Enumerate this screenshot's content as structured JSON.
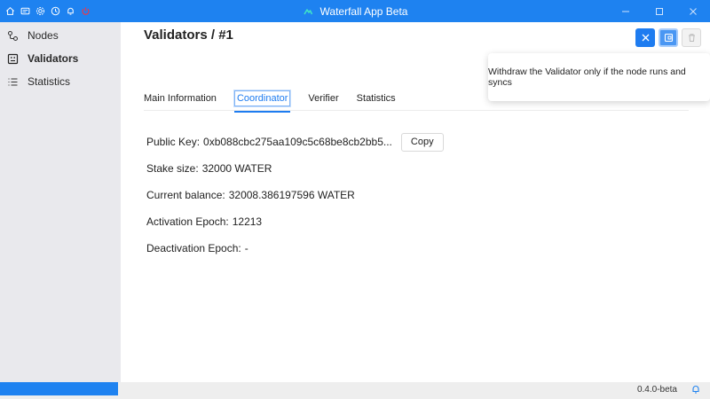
{
  "window": {
    "title": "Waterfall App Beta",
    "accent_color": "#1e82f0",
    "left_icons": [
      "home-icon",
      "wallet-icon",
      "settings-icon",
      "clock-icon",
      "bell-icon",
      "power-icon"
    ],
    "controls": [
      "minimize-icon",
      "maximize-icon",
      "close-icon"
    ]
  },
  "sidebar": {
    "items": [
      {
        "label": "Nodes",
        "icon": "nodes-icon",
        "active": false
      },
      {
        "label": "Validators",
        "icon": "validator-icon",
        "active": true
      },
      {
        "label": "Statistics",
        "icon": "list-icon",
        "active": false
      }
    ]
  },
  "page": {
    "title": "Validators / #1"
  },
  "actions": {
    "tooltip": "Withdraw the Validator only if the node runs and syncs"
  },
  "tabs": [
    {
      "label": "Main Information",
      "active": false
    },
    {
      "label": "Coordinator",
      "active": true
    },
    {
      "label": "Verifier",
      "active": false
    },
    {
      "label": "Statistics",
      "active": false
    }
  ],
  "info": {
    "public_key_label": "Public Key:",
    "public_key_value": "0xb088cbc275aa109c5c68be8cb2bb5...",
    "copy_label": "Copy",
    "stake_label": "Stake size:",
    "stake_value": "32000 WATER",
    "balance_label": "Current balance:",
    "balance_value": "32008.386197596 WATER",
    "activation_label": "Activation Epoch:",
    "activation_value": "12213",
    "deactivation_label": "Deactivation Epoch:",
    "deactivation_value": "-"
  },
  "statusbar": {
    "version": "0.4.0-beta",
    "progress_fraction": 0.166
  }
}
